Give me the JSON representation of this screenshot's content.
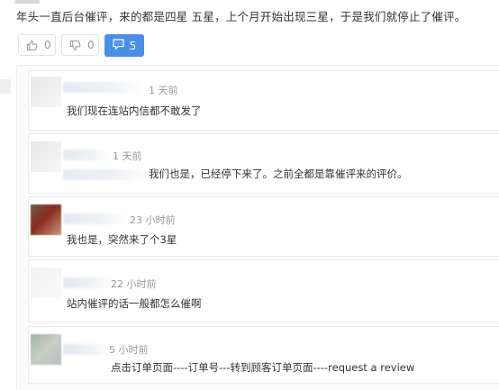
{
  "post": {
    "text": "年头一直后台催评，来的都是四星 五星，上个月开始出现三星，于是我们就停止了催评。"
  },
  "actions": {
    "like_count": "0",
    "dislike_count": "0",
    "comment_count": "5",
    "accent_color": "#4a8fe7"
  },
  "replies": [
    {
      "time": "1 天前",
      "body": "我们现在连站内信都不敢发了"
    },
    {
      "time": "1 天前",
      "body": "我们也是，已经停下来了。之前全都是靠催评来的评价。"
    },
    {
      "time": "23 小时前",
      "body": "我也是，突然来了个3星"
    },
    {
      "time": "22 小时前",
      "body": "站内催评的话一般都怎么催啊"
    },
    {
      "time": "5 小时前",
      "body": "点击订单页面----订单号---转到顾客订单页面----request a review"
    }
  ]
}
